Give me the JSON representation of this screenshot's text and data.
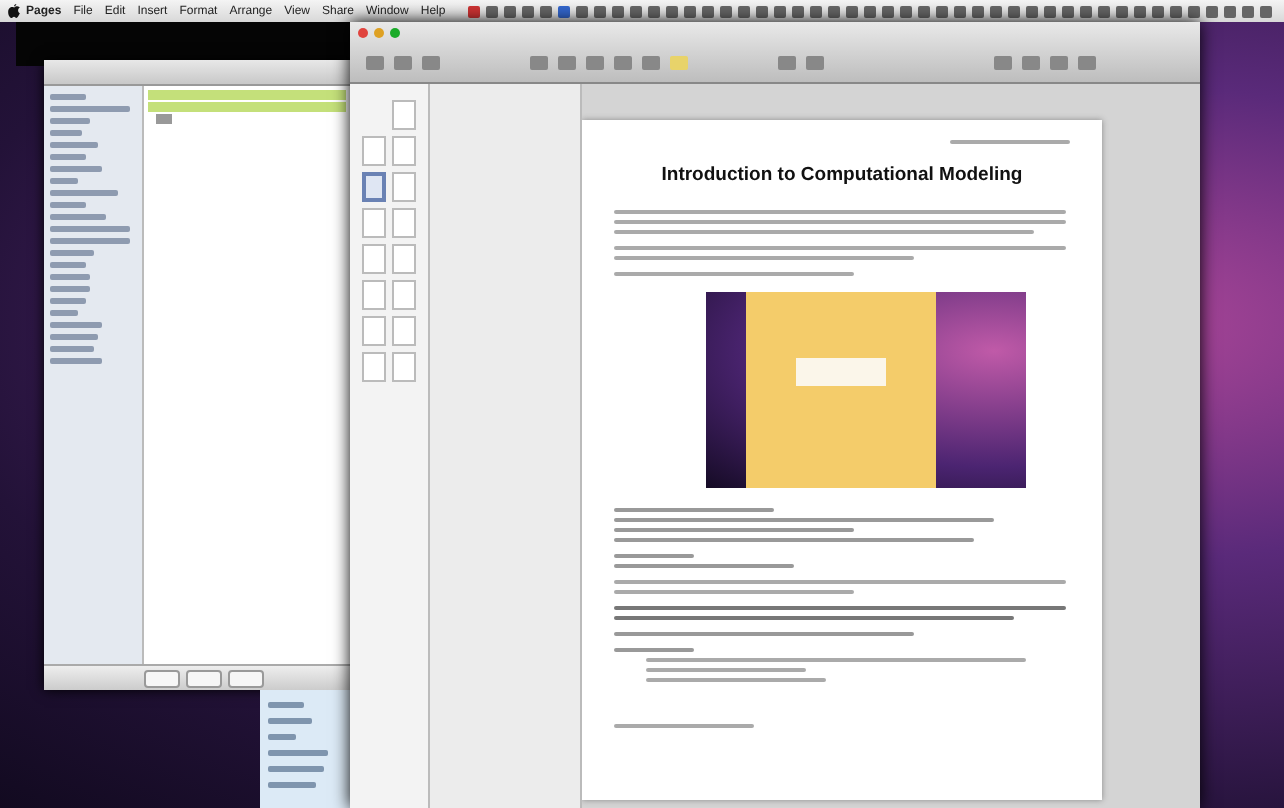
{
  "menu_bar": {
    "items": [
      "Pages",
      "File",
      "Edit",
      "Insert",
      "Format",
      "Arrange",
      "View",
      "Share",
      "Window",
      "Help"
    ]
  },
  "finder": {
    "files": [
      {
        "selected": true
      },
      {
        "selected": true
      },
      {
        "selected": false
      }
    ]
  },
  "pages": {
    "thumbnails": [
      {
        "selected": false
      },
      {
        "selected": false
      },
      {
        "selected": false
      },
      {
        "selected": true
      },
      {
        "selected": false
      },
      {
        "selected": false
      },
      {
        "selected": false
      },
      {
        "selected": false
      },
      {
        "selected": false
      },
      {
        "selected": false
      },
      {
        "selected": false
      },
      {
        "selected": false
      },
      {
        "selected": false
      },
      {
        "selected": false
      },
      {
        "selected": false
      }
    ],
    "document": {
      "title": "Introduction to Computational Modeling"
    }
  }
}
